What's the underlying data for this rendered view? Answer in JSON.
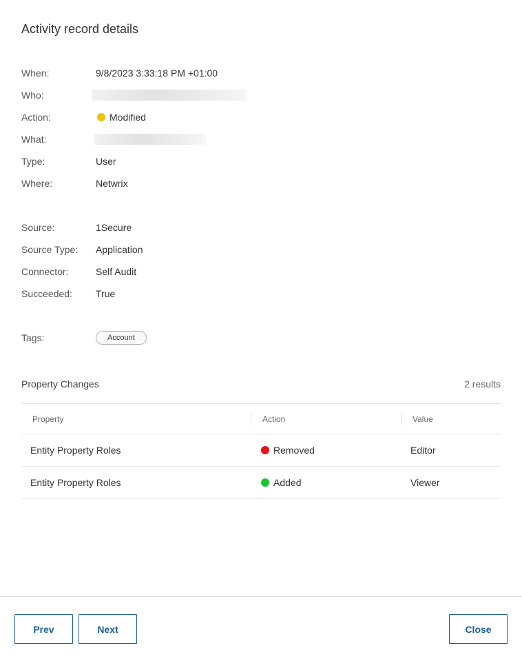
{
  "dialog": {
    "title": "Activity record details"
  },
  "details": {
    "when": {
      "label": "When:",
      "value": "9/8/2023 3:33:18 PM +01:00"
    },
    "who": {
      "label": "Who:"
    },
    "action": {
      "label": "Action:",
      "value": "Modified",
      "color": "#f2c10c"
    },
    "what": {
      "label": "What:"
    },
    "type": {
      "label": "Type:",
      "value": "User"
    },
    "where": {
      "label": "Where:",
      "value": "Netwrix"
    },
    "source": {
      "label": "Source:",
      "value": "1Secure"
    },
    "source_type": {
      "label": "Source Type:",
      "value": "Application"
    },
    "connector": {
      "label": "Connector:",
      "value": "Self Audit"
    },
    "succeeded": {
      "label": "Succeeded:",
      "value": "True"
    },
    "tags": {
      "label": "Tags:",
      "items": [
        "Account"
      ]
    }
  },
  "property_changes": {
    "title": "Property Changes",
    "count_label": "2 results",
    "columns": [
      "Property",
      "Action",
      "Value"
    ],
    "rows": [
      {
        "property": "Entity Property Roles",
        "action": "Removed",
        "action_color": "#e8111a",
        "value": "Editor"
      },
      {
        "property": "Entity Property Roles",
        "action": "Added",
        "action_color": "#17c52b",
        "value": "Viewer"
      }
    ]
  },
  "footer": {
    "prev_label": "Prev",
    "next_label": "Next",
    "close_label": "Close"
  }
}
